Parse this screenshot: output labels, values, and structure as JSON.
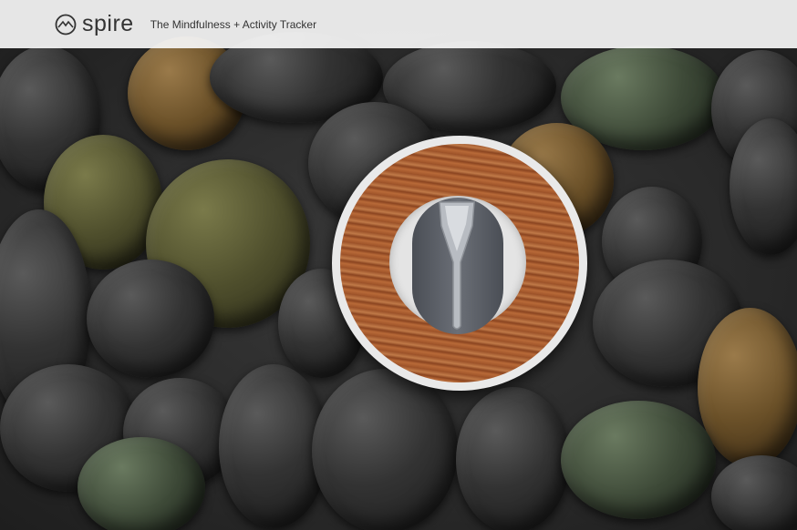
{
  "header": {
    "brand": "spire",
    "tagline": "The Mindfulness + Activity Tracker"
  },
  "hero": {
    "image_description_icon": "spire-device-on-stones-image"
  },
  "colors": {
    "topbar_bg": "#f5f5f5",
    "text": "#333333"
  }
}
